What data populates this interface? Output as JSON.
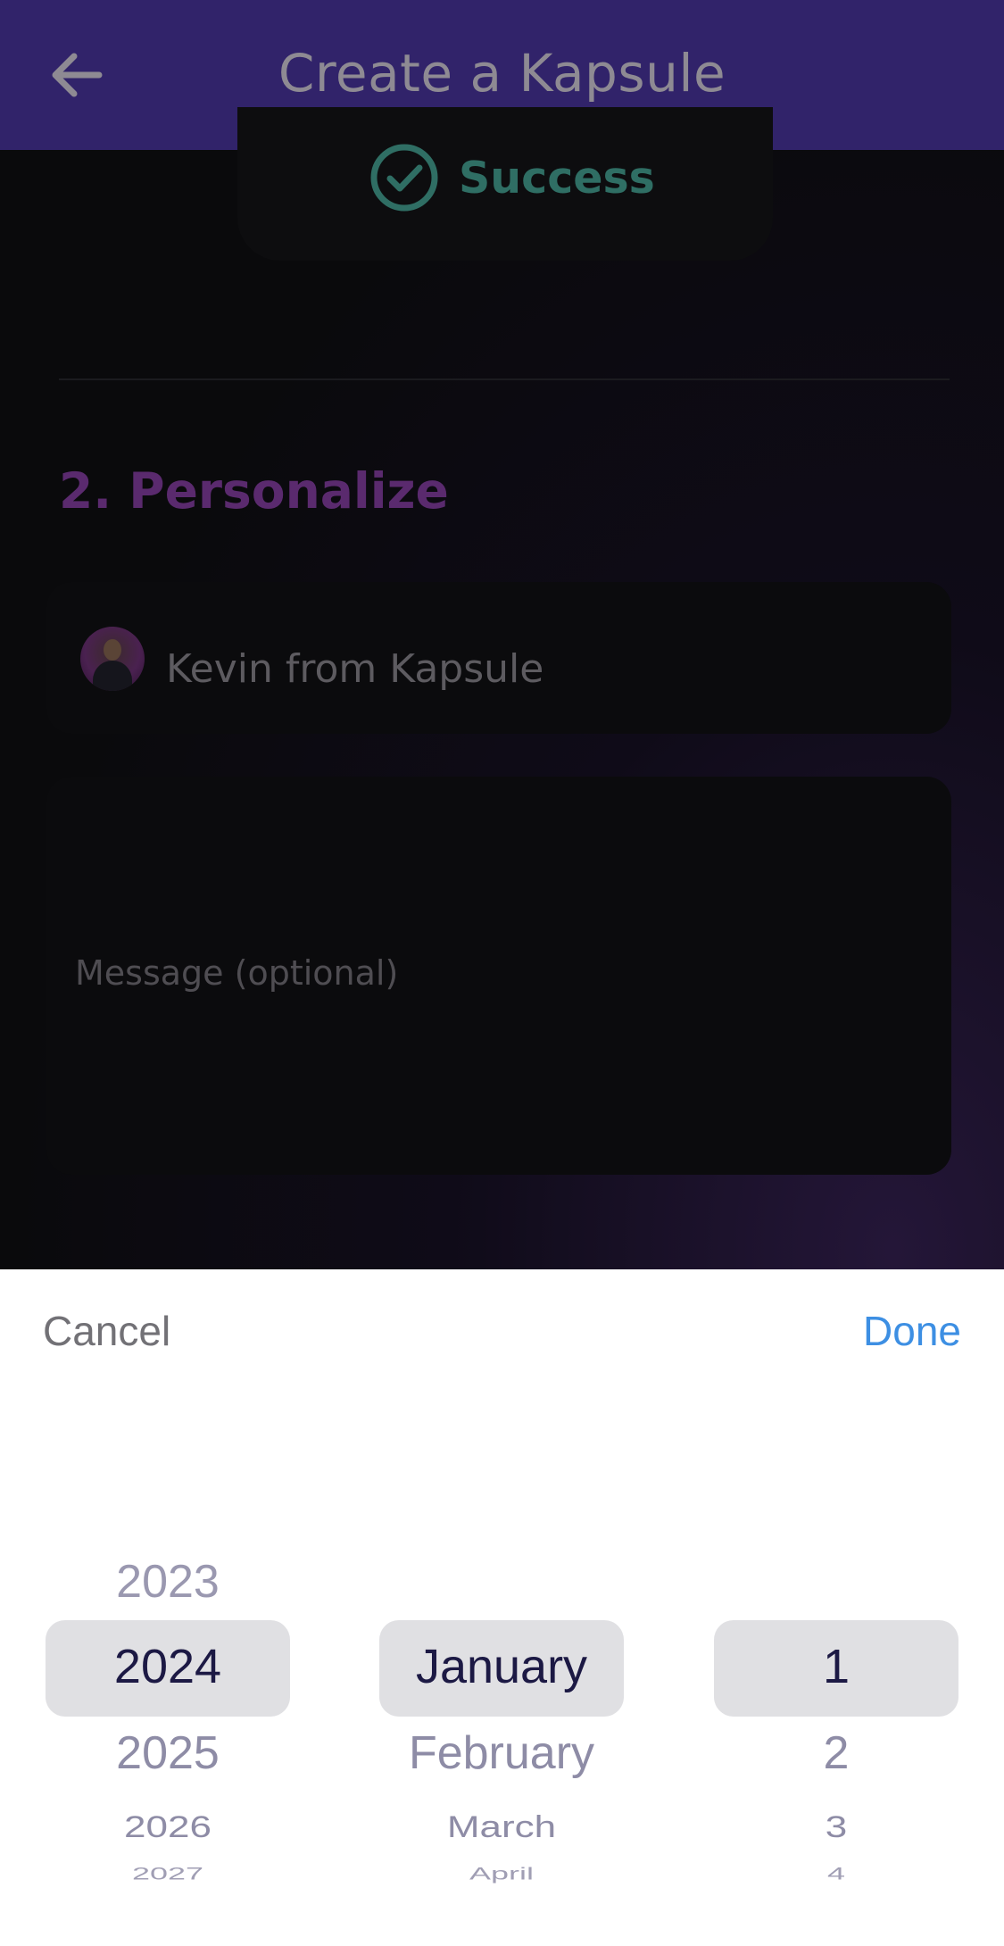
{
  "header": {
    "title": "Create a Kapsule",
    "back_icon": "arrow-left-icon"
  },
  "status": {
    "label": "Success",
    "icon": "check-circle-icon",
    "color": "#2f6e64"
  },
  "section": {
    "title": "2. Personalize",
    "color": "#5a2a6e"
  },
  "sender": {
    "name": "Kevin from Kapsule"
  },
  "message": {
    "placeholder": "Message (optional)"
  },
  "picker": {
    "cancel_label": "Cancel",
    "done_label": "Done",
    "accent_color": "#3d8fe3",
    "years": {
      "prev": "2023",
      "selected": "2024",
      "next": [
        "2025",
        "2026",
        "2027"
      ]
    },
    "months": {
      "selected": "January",
      "next": [
        "February",
        "March",
        "April"
      ]
    },
    "days": {
      "selected": "1",
      "next": [
        "2",
        "3",
        "4"
      ]
    }
  }
}
